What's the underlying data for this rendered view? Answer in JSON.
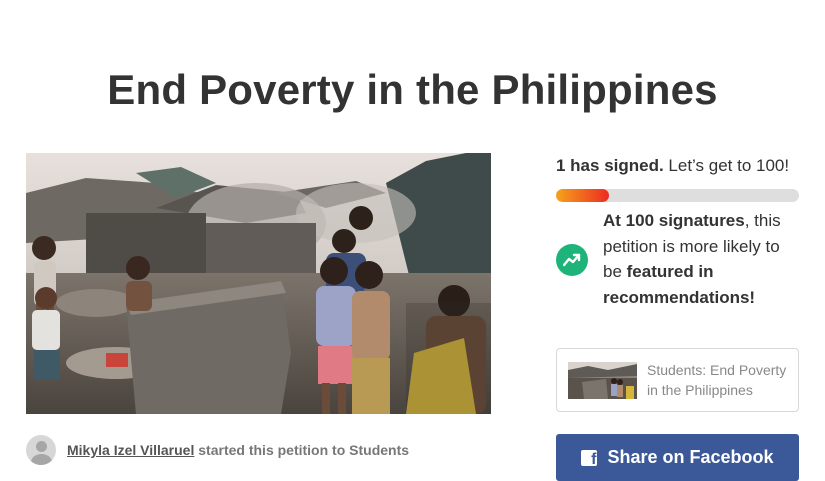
{
  "page": {
    "title": "End Poverty in the Philippines"
  },
  "hero_image": {
    "alt": "Children standing in a slum area"
  },
  "author": {
    "name": "Mikyla Izel Villaruel",
    "suffix": " started this petition to Students"
  },
  "progress": {
    "signed_count": "1 has signed.",
    "goal_text": " Let’s get to 100!",
    "fraction": 0.22
  },
  "milestone": {
    "strong_1": "At 100 signatures",
    "text_1": ", this petition is more likely to be ",
    "strong_2": "featured in recommendations!"
  },
  "related_card": {
    "title": "Students: End Poverty in the Philippines"
  },
  "share": {
    "facebook_label": "Share on Facebook"
  },
  "colors": {
    "accent_green": "#1eb479",
    "facebook_blue": "#3b5998",
    "progress_start": "#f7a21b",
    "progress_end": "#ec2c22"
  },
  "icons": {
    "trend": "trending-up-icon",
    "facebook": "facebook-icon",
    "avatar": "user-avatar-icon"
  }
}
